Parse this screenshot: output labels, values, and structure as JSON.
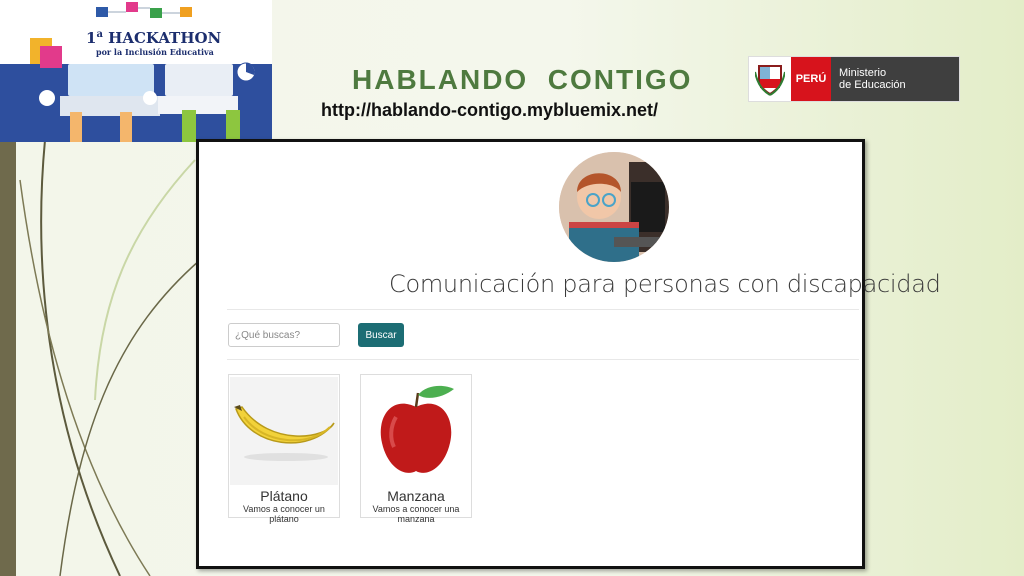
{
  "header": {
    "title": "HABLANDO  CONTIGO",
    "url": "http://hablando-contigo.mybluemix.net/"
  },
  "banner": {
    "ordinal": "1",
    "ordinal_sup": "a",
    "title": "HACKATHON",
    "subtitle": "por la Inclusión Educativa"
  },
  "ministry": {
    "country": "PERÚ",
    "line1": "Ministerio",
    "line2": "de Educación"
  },
  "app": {
    "title": "Comunicación para personas con discapacidad",
    "search": {
      "placeholder": "¿Qué buscas?",
      "value": "",
      "button_label": "Buscar"
    },
    "cards": [
      {
        "name": "Plátano",
        "description": "Vamos a conocer un plátano",
        "icon": "banana-image"
      },
      {
        "name": "Manzana",
        "description": "Vamos a conocer una manzana",
        "icon": "apple-image"
      }
    ]
  },
  "colors": {
    "title_green": "#4e7a3f",
    "button_teal": "#1c6d74",
    "peru_red": "#d7131c",
    "olive_bar": "#6f6a4c"
  }
}
